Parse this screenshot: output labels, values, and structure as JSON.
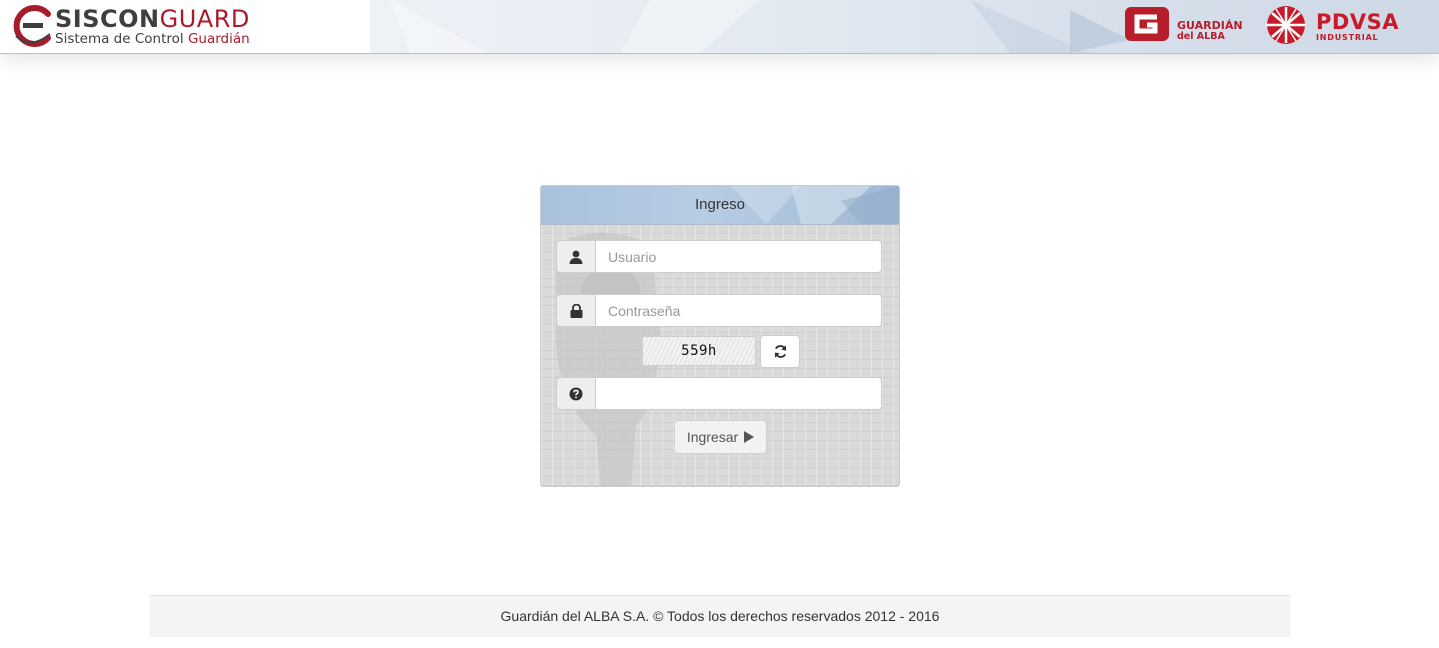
{
  "header": {
    "brand_part1": "SISCON",
    "brand_part2": "GUARD",
    "subtitle_part1": "Sistema de Control ",
    "subtitle_part2": "Guardián",
    "partner1_line1": "GUARDIÁN",
    "partner1_line2": "del ALBA",
    "partner2_name": "PDVSA",
    "partner2_sub": "INDUSTRIAL",
    "accent_color": "#a81c2a"
  },
  "login": {
    "title": "Ingreso",
    "username_placeholder": "Usuario",
    "password_placeholder": "Contraseña",
    "captcha_text": "559h",
    "captcha_input_value": "",
    "submit_label": "Ingresar",
    "icons": [
      "user-icon",
      "lock-icon",
      "refresh-icon",
      "question-circle-icon",
      "play-icon"
    ]
  },
  "footer": {
    "text": "Guardián del ALBA S.A. © Todos los derechos reservados 2012 - 2016"
  }
}
